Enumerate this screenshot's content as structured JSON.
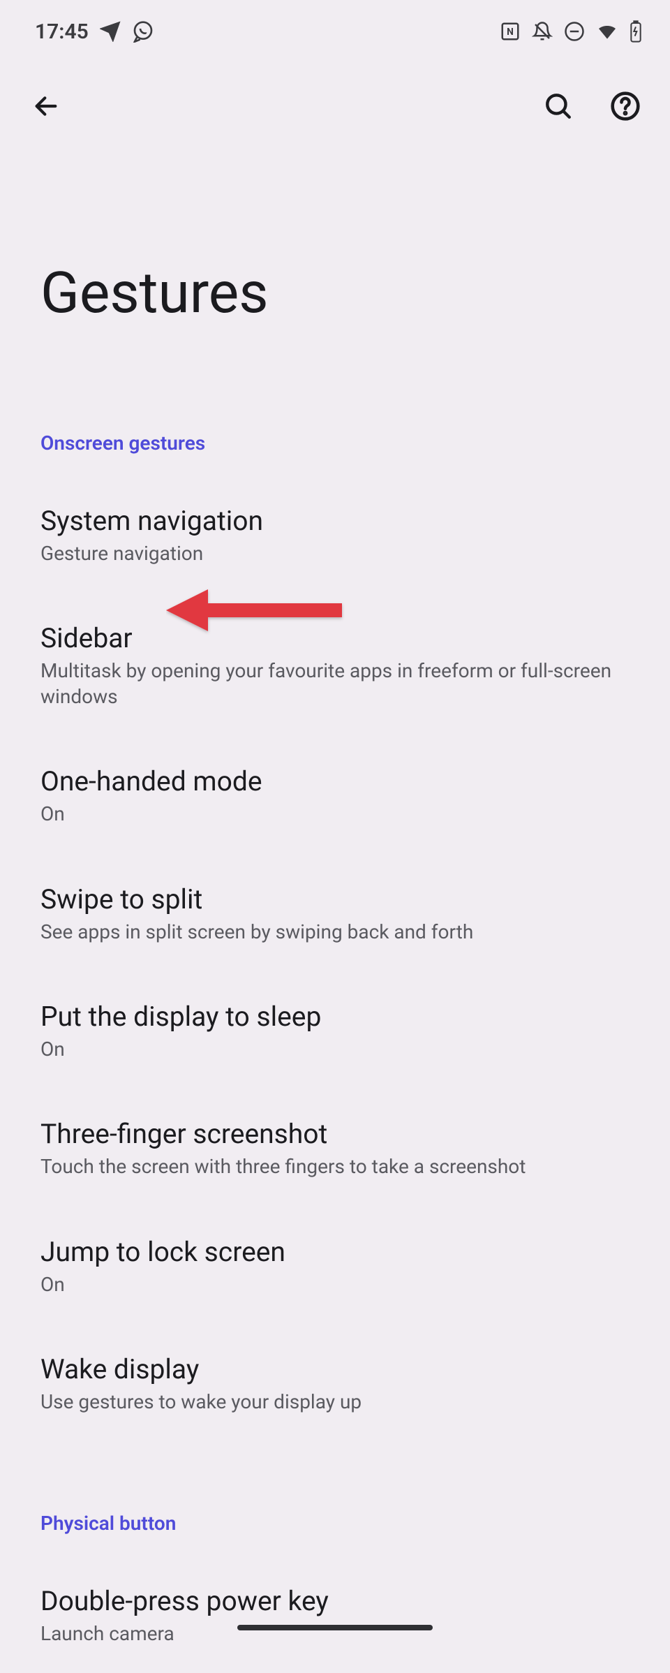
{
  "status": {
    "time": "17:45"
  },
  "page": {
    "title": "Gestures"
  },
  "sections": [
    {
      "header": "Onscreen gestures"
    },
    {
      "header": "Physical button"
    }
  ],
  "items": {
    "onscreen": [
      {
        "title": "System navigation",
        "sub": "Gesture navigation"
      },
      {
        "title": "Sidebar",
        "sub": "Multitask by opening your favourite apps in freeform or full-screen windows"
      },
      {
        "title": "One-handed mode",
        "sub": "On"
      },
      {
        "title": "Swipe to split",
        "sub": "See apps in split screen by swiping back and forth"
      },
      {
        "title": "Put the display to sleep",
        "sub": "On"
      },
      {
        "title": "Three-finger screenshot",
        "sub": "Touch the screen with three fingers to take a screenshot"
      },
      {
        "title": "Jump to lock screen",
        "sub": "On"
      },
      {
        "title": "Wake display",
        "sub": "Use gestures to wake your display up"
      }
    ],
    "physical": [
      {
        "title": "Double-press power key",
        "sub": "Launch camera"
      }
    ]
  }
}
